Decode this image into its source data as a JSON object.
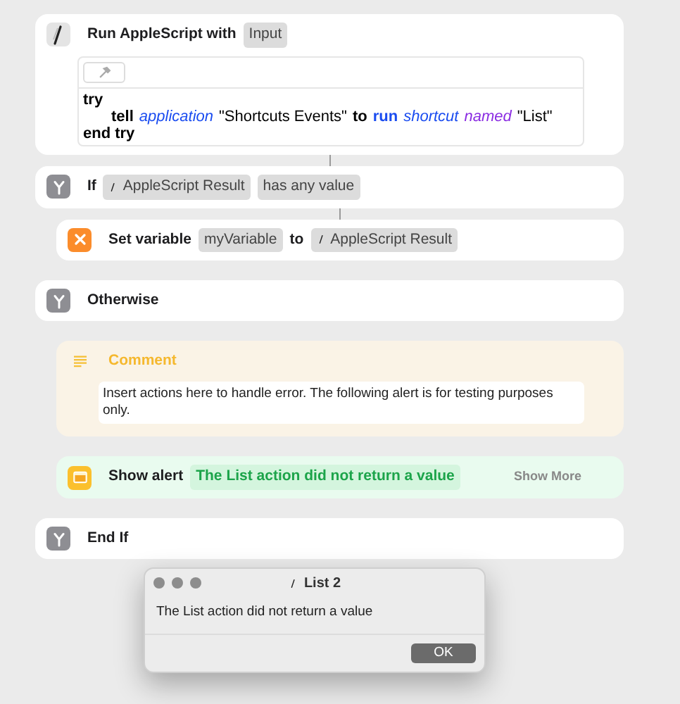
{
  "actions": [
    {
      "kind": "applescript",
      "parts": [
        {
          "kind": "label",
          "text": "Run AppleScript with"
        },
        {
          "kind": "token",
          "text": "Input"
        }
      ],
      "code": [
        {
          "indented": false,
          "tokens": [
            {
              "kind": "keyword",
              "text": "try"
            }
          ]
        },
        {
          "indented": true,
          "tokens": [
            {
              "kind": "keyword",
              "text": "tell"
            },
            {
              "kind": "class",
              "text": "application"
            },
            {
              "kind": "string",
              "text": "\"Shortcuts Events\""
            },
            {
              "kind": "keyword",
              "text": "to"
            },
            {
              "kind": "command",
              "text": "run"
            },
            {
              "kind": "class",
              "text": "shortcut"
            },
            {
              "kind": "param",
              "text": "named"
            },
            {
              "kind": "string",
              "text": "\"List\""
            }
          ]
        },
        {
          "indented": false,
          "tokens": [
            {
              "kind": "keyword",
              "text": "end try"
            }
          ]
        }
      ]
    },
    {
      "kind": "if",
      "parts": [
        {
          "kind": "label",
          "text": "If"
        },
        {
          "kind": "variable",
          "text": "AppleScript Result"
        },
        {
          "kind": "token",
          "text": "has any value"
        }
      ],
      "children": [
        {
          "kind": "set_variable",
          "parts": [
            {
              "kind": "label",
              "text": "Set variable"
            },
            {
              "kind": "token",
              "text": "myVariable"
            },
            {
              "kind": "label",
              "text": "to"
            },
            {
              "kind": "variable",
              "text": "AppleScript Result"
            }
          ]
        }
      ]
    },
    {
      "kind": "otherwise",
      "parts": [
        {
          "kind": "label",
          "text": "Otherwise"
        }
      ],
      "children": [
        {
          "kind": "comment",
          "parts": [
            {
              "kind": "label",
              "text": "Comment"
            }
          ],
          "body": "Insert actions here to handle error. The following alert is for testing purposes only."
        },
        {
          "kind": "alert",
          "parts": [
            {
              "kind": "label",
              "text": "Show alert"
            },
            {
              "kind": "message",
              "text": "The List action did not return a value"
            }
          ],
          "more": "Show More"
        }
      ]
    },
    {
      "kind": "endif",
      "parts": [
        {
          "kind": "label",
          "text": "End If"
        }
      ]
    }
  ],
  "dialog": {
    "title": "List 2",
    "message": "The List action did not return a value",
    "button": "OK"
  }
}
